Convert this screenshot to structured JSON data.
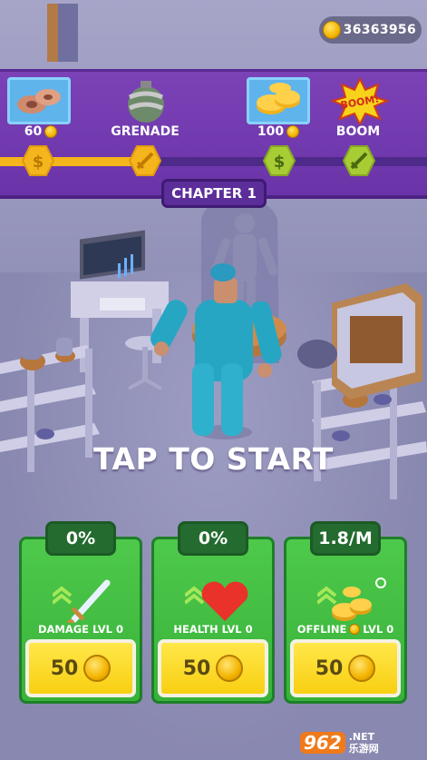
{
  "currency": {
    "icon": "coin-icon",
    "value": "36363956"
  },
  "progress": {
    "rewards": [
      {
        "label": "60",
        "has_coin": true,
        "icon": "weights-icon",
        "selected": true
      },
      {
        "label": "GRENADE",
        "has_coin": false,
        "icon": "grenade-icon",
        "selected": false
      },
      {
        "label": "100",
        "has_coin": true,
        "icon": "coin-stack-icon",
        "selected": true
      },
      {
        "label": "BOOM",
        "has_coin": false,
        "icon": "boom-icon",
        "selected": false
      }
    ],
    "boom_text": "BOOM!",
    "fill": 0.32
  },
  "chapter": {
    "label": "CHAPTER 1"
  },
  "tap_to_start": "TAP TO START",
  "upgrades": [
    {
      "value": "0%",
      "label": "DAMAGE LVL 0",
      "cost": "50",
      "icon": "sword-icon"
    },
    {
      "value": "0%",
      "label": "HEALTH LVL  0",
      "cost": "50",
      "icon": "heart-icon"
    },
    {
      "value": "1.8/M",
      "label_pre": "OFFLINE",
      "label_post": "LVL 0",
      "cost": "50",
      "icon": "coin-stack-icon"
    }
  ],
  "colors": {
    "purple_bar": "#6a34a8",
    "card_green": "#38b23a",
    "buy_yellow": "#f8cf12",
    "coin_gold": "#f4b400"
  },
  "watermark": {
    "logo": "962",
    "suffix": ".NET",
    "sub": "乐游网"
  }
}
